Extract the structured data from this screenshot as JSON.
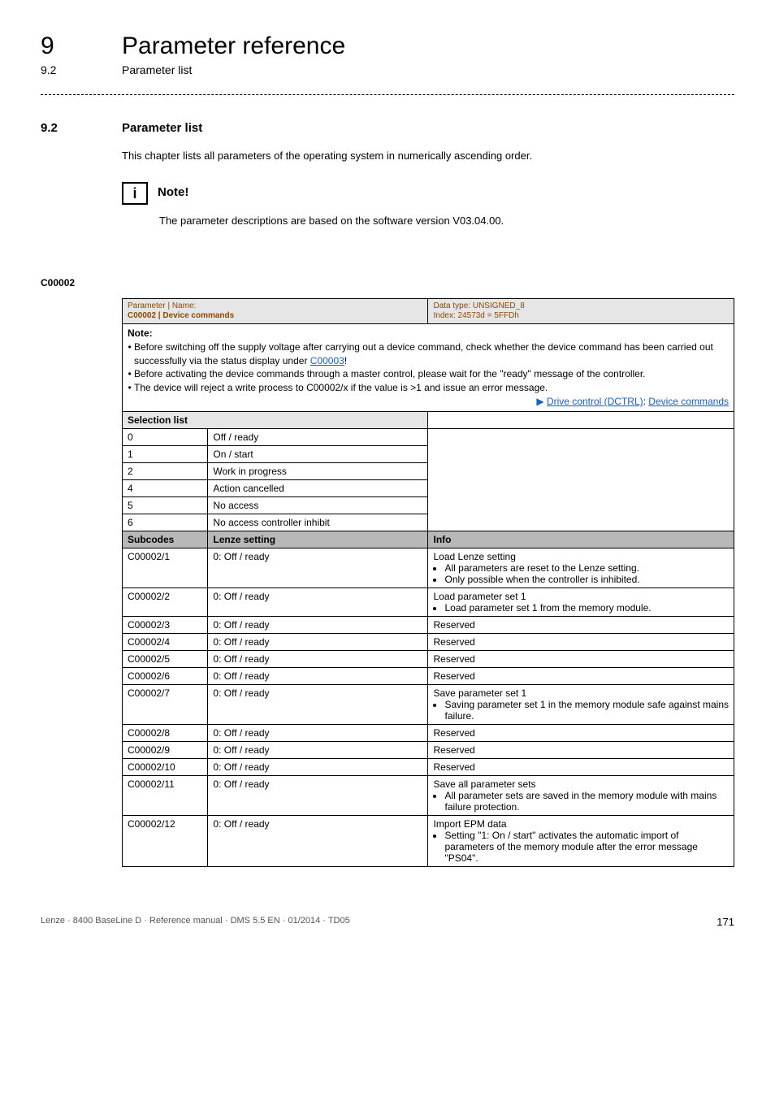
{
  "header": {
    "chapter_number": "9",
    "chapter_title": "Parameter reference",
    "section_number": "9.2",
    "section_title": "Parameter list"
  },
  "section": {
    "number": "9.2",
    "title": "Parameter list",
    "intro": "This chapter lists all parameters of the operating system in numerically ascending order."
  },
  "note": {
    "label": "Note!",
    "text": "The parameter descriptions are based on the software version V03.04.00."
  },
  "param_anchor": "C00002",
  "param_header": {
    "left_label": "Parameter | Name:",
    "code_name": "C00002 | Device commands",
    "data_type": "Data type: UNSIGNED_8",
    "index": "Index: 24573d = 5FFDh"
  },
  "param_note": {
    "heading": "Note:",
    "bullets": [
      "Before switching off the supply voltage after carrying out a device command, check whether the device command has been carried out successfully via the status display under ",
      "Before activating the device commands through a master control, please wait for the \"ready\" message of the controller.",
      "The device will reject a write process to C00002/x if the value is >1 and issue an error message."
    ],
    "link_c00003": "C00003",
    "right_link_prefix": "Drive control (DCTRL)",
    "right_link_sep": ": ",
    "right_link_suffix": "Device commands"
  },
  "selection_list_label": "Selection list",
  "selection_list": [
    {
      "idx": "0",
      "label": "Off / ready"
    },
    {
      "idx": "1",
      "label": "On / start"
    },
    {
      "idx": "2",
      "label": "Work in progress"
    },
    {
      "idx": "4",
      "label": "Action cancelled"
    },
    {
      "idx": "5",
      "label": "No access"
    },
    {
      "idx": "6",
      "label": "No access controller inhibit"
    }
  ],
  "subcodes_header": {
    "col1": "Subcodes",
    "col2": "Lenze setting",
    "col3": "Info"
  },
  "subcodes": [
    {
      "code": "C00002/1",
      "setting": "0: Off / ready",
      "info_title": "Load Lenze setting",
      "info_bullets": [
        "All parameters are reset to the Lenze setting.",
        "Only possible when the controller is inhibited."
      ]
    },
    {
      "code": "C00002/2",
      "setting": "0: Off / ready",
      "info_title": "Load parameter set 1",
      "info_bullets": [
        "Load parameter set 1 from the memory module."
      ]
    },
    {
      "code": "C00002/3",
      "setting": "0: Off / ready",
      "info_title": "Reserved",
      "info_bullets": []
    },
    {
      "code": "C00002/4",
      "setting": "0: Off / ready",
      "info_title": "Reserved",
      "info_bullets": []
    },
    {
      "code": "C00002/5",
      "setting": "0: Off / ready",
      "info_title": "Reserved",
      "info_bullets": []
    },
    {
      "code": "C00002/6",
      "setting": "0: Off / ready",
      "info_title": "Reserved",
      "info_bullets": []
    },
    {
      "code": "C00002/7",
      "setting": "0: Off / ready",
      "info_title": "Save parameter set 1",
      "info_bullets": [
        "Saving parameter set 1 in the memory module safe against mains failure."
      ]
    },
    {
      "code": "C00002/8",
      "setting": "0: Off / ready",
      "info_title": "Reserved",
      "info_bullets": []
    },
    {
      "code": "C00002/9",
      "setting": "0: Off / ready",
      "info_title": "Reserved",
      "info_bullets": []
    },
    {
      "code": "C00002/10",
      "setting": "0: Off / ready",
      "info_title": "Reserved",
      "info_bullets": []
    },
    {
      "code": "C00002/11",
      "setting": "0: Off / ready",
      "info_title": "Save all parameter sets",
      "info_bullets": [
        "All parameter sets are saved in the memory module with mains failure protection."
      ]
    },
    {
      "code": "C00002/12",
      "setting": "0: Off / ready",
      "info_title": "Import EPM data",
      "info_bullets": [
        "Setting \"1: On / start\" activates the automatic import of parameters of the memory module after the error message \"PS04\"."
      ]
    }
  ],
  "footer": {
    "left": "Lenze · 8400 BaseLine D · Reference manual · DMS 5.5 EN · 01/2014 · TD05",
    "page": "171"
  }
}
